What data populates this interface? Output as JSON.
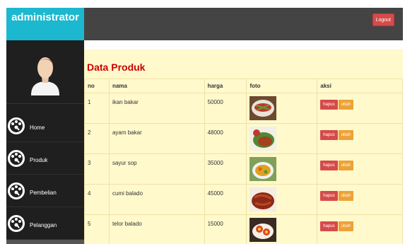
{
  "header": {
    "brand": "administrator",
    "logout_label": "Logout"
  },
  "sidebar": {
    "items": [
      {
        "label": "Home"
      },
      {
        "label": "Produk"
      },
      {
        "label": "Pembelian"
      },
      {
        "label": "Pelanggan"
      }
    ]
  },
  "page": {
    "title": "Data Produk"
  },
  "table": {
    "headers": {
      "no": "no",
      "nama": "nama",
      "harga": "harga",
      "foto": "foto",
      "aksi": "aksi"
    },
    "rows": [
      {
        "no": "1",
        "nama": "ikan bakar",
        "harga": "50000"
      },
      {
        "no": "2",
        "nama": "ayam bakar",
        "harga": "48000"
      },
      {
        "no": "3",
        "nama": "sayur sop",
        "harga": "35000"
      },
      {
        "no": "4",
        "nama": "cumi balado",
        "harga": "45000"
      },
      {
        "no": "5",
        "nama": "telor balado",
        "harga": "15000"
      }
    ],
    "actions": {
      "hapus": "hapus",
      "ubah": "ubah"
    }
  },
  "colors": {
    "brand": "#1cb8cf",
    "topbar": "#444444",
    "sidebar": "#1f1f1f",
    "content_bg": "#fff9cc",
    "title": "#cc0000",
    "danger": "#d64a4a",
    "warning": "#eea236"
  }
}
